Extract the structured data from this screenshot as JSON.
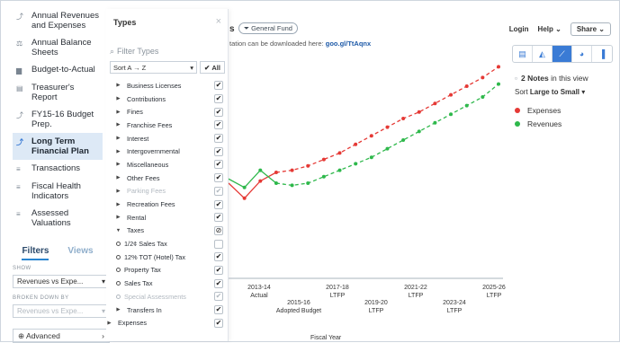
{
  "sidebar": {
    "items": [
      {
        "label": "Annual Revenues and Expenses",
        "icon": "line-chart-icon",
        "active": false
      },
      {
        "label": "Annual Balance Sheets",
        "icon": "balance-sheet-icon",
        "active": false
      },
      {
        "label": "Budget-to-Actual",
        "icon": "bar-chart-icon",
        "active": false
      },
      {
        "label": "Treasurer's Report",
        "icon": "report-icon",
        "active": false
      },
      {
        "label": "FY15-16 Budget Prep.",
        "icon": "line-chart-icon",
        "active": false
      },
      {
        "label": "Long Term Financial Plan",
        "icon": "line-chart-icon",
        "active": true
      },
      {
        "label": "Transactions",
        "icon": "stack-icon",
        "active": false
      },
      {
        "label": "Fiscal Health Indicators",
        "icon": "stack-icon",
        "active": false
      },
      {
        "label": "Assessed Valuations",
        "icon": "stack-icon",
        "active": false
      }
    ],
    "tabs": {
      "filters": "Filters",
      "views": "Views"
    },
    "show_label": "SHOW",
    "show_value": "Revenues vs Expe...",
    "broken_label": "BROKEN DOWN BY",
    "broken_value": "Revenues vs Expe...",
    "advanced": "Advanced"
  },
  "types_panel": {
    "title": "Types",
    "close": "×",
    "filter_placeholder": "Filter Types",
    "sort": "Sort A → Z",
    "all": "All",
    "rows": [
      {
        "label": "Business Licenses",
        "kind": "arrow",
        "check": "✔",
        "dim": false
      },
      {
        "label": "Contributions",
        "kind": "arrow",
        "check": "✔",
        "dim": false
      },
      {
        "label": "Fines",
        "kind": "arrow",
        "check": "✔",
        "dim": false
      },
      {
        "label": "Franchise Fees",
        "kind": "arrow",
        "check": "✔",
        "dim": false
      },
      {
        "label": "Interest",
        "kind": "arrow",
        "check": "✔",
        "dim": false
      },
      {
        "label": "Intergovernmental",
        "kind": "arrow",
        "check": "✔",
        "dim": false
      },
      {
        "label": "Miscellaneous",
        "kind": "arrow",
        "check": "✔",
        "dim": false
      },
      {
        "label": "Other Fees",
        "kind": "arrow",
        "check": "✔",
        "dim": false
      },
      {
        "label": "Parking Fees",
        "kind": "arrow",
        "check": "✔",
        "dim": true
      },
      {
        "label": "Recreation Fees",
        "kind": "arrow",
        "check": "✔",
        "dim": false
      },
      {
        "label": "Rental",
        "kind": "arrow",
        "check": "✔",
        "dim": false
      },
      {
        "label": "Taxes",
        "kind": "down",
        "check": "⊘",
        "dim": false
      },
      {
        "label": "1/2¢ Sales Tax",
        "kind": "circle",
        "check": "",
        "dim": false
      },
      {
        "label": "12% TOT (Hotel) Tax",
        "kind": "circle",
        "check": "✔",
        "dim": false
      },
      {
        "label": "Property Tax",
        "kind": "circle",
        "check": "✔",
        "dim": false
      },
      {
        "label": "Sales Tax",
        "kind": "circle",
        "check": "✔",
        "dim": false
      },
      {
        "label": "Special Assessments",
        "kind": "circle",
        "check": "✔",
        "dim": true
      },
      {
        "label": "Transfers In",
        "kind": "arrow",
        "check": "✔",
        "dim": false
      },
      {
        "label": "Expenses",
        "kind": "arrow-outer",
        "check": "✔",
        "dim": false
      }
    ]
  },
  "header": {
    "title_fragment": "s",
    "fund_pill": "General Fund",
    "subtitle_prefix": "tation can be downloaded here: ",
    "subtitle_link": "goo.gl/TtAqnx",
    "login": "Login",
    "help": "Help",
    "share": "Share"
  },
  "side_info": {
    "notes_count": "2 Notes",
    "notes_suffix": " in this view",
    "sort_prefix": "Sort ",
    "sort_value": "Large to Small",
    "legend": [
      {
        "label": "Expenses",
        "color": "#e53935"
      },
      {
        "label": "Revenues",
        "color": "#2eb84b"
      }
    ]
  },
  "chart_data": {
    "type": "line",
    "x_ticks": [
      {
        "label": "2013-14\nActual",
        "row": 0
      },
      {
        "label": "2015-16\nAdopted Budget",
        "row": 1
      },
      {
        "label": "2017-18\nLTFP",
        "row": 0
      },
      {
        "label": "2019-20\nLTFP",
        "row": 1
      },
      {
        "label": "2021-22\nLTFP",
        "row": 0
      },
      {
        "label": "2023-24\nLTFP",
        "row": 1
      },
      {
        "label": "2025-26\nLTFP",
        "row": 0
      }
    ],
    "xlabel": "Fiscal Year",
    "series": [
      {
        "name": "Expenses",
        "color": "#e53935",
        "values": [
          0.4,
          0.33,
          0.41,
          0.45,
          0.46,
          0.48,
          0.51,
          0.54,
          0.58,
          0.62,
          0.66,
          0.7,
          0.73,
          0.77,
          0.81,
          0.85,
          0.89,
          0.94
        ]
      },
      {
        "name": "Revenues",
        "color": "#2eb84b",
        "values": [
          0.42,
          0.38,
          0.46,
          0.4,
          0.39,
          0.4,
          0.43,
          0.46,
          0.49,
          0.52,
          0.56,
          0.6,
          0.64,
          0.68,
          0.72,
          0.76,
          0.8,
          0.86
        ]
      }
    ]
  }
}
